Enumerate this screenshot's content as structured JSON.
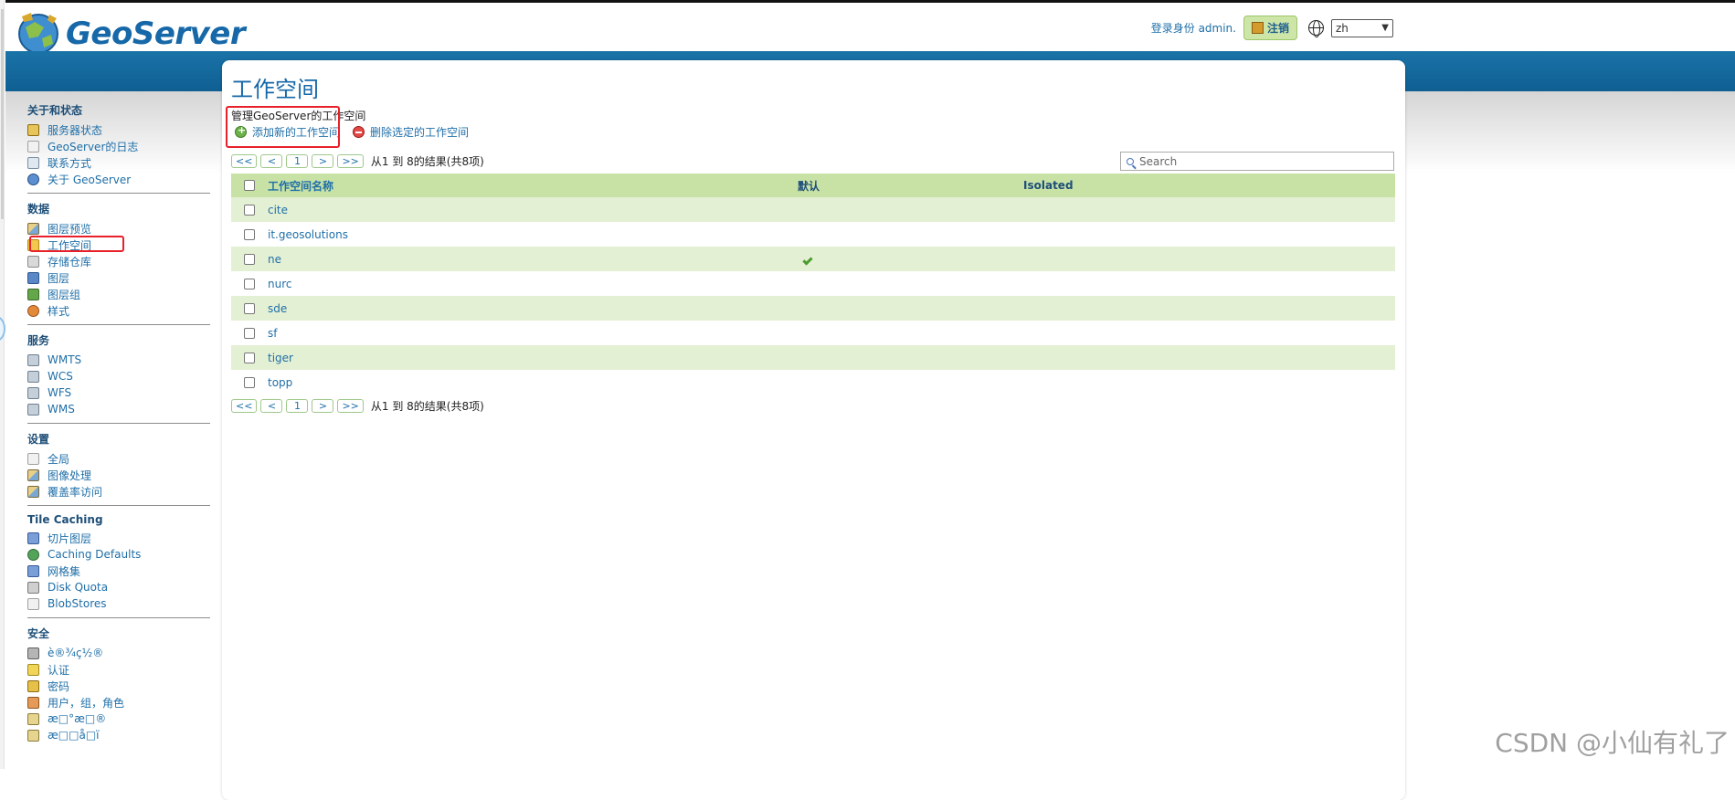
{
  "header": {
    "brand": "GeoServer",
    "login_label": "登录身份 admin.",
    "logout_label": "注销",
    "language": "zh"
  },
  "sidebar": {
    "sections": [
      {
        "title": "关于和状态",
        "items": [
          {
            "label": "服务器状态",
            "icon": "server-status-icon"
          },
          {
            "label": "GeoServer的日志",
            "icon": "log-icon"
          },
          {
            "label": "联系方式",
            "icon": "contact-icon"
          },
          {
            "label": "关于 GeoServer",
            "icon": "info-icon"
          }
        ]
      },
      {
        "title": "数据",
        "items": [
          {
            "label": "图层预览",
            "icon": "map-preview-icon"
          },
          {
            "label": "工作空间",
            "icon": "folder-icon"
          },
          {
            "label": "存储仓库",
            "icon": "store-icon"
          },
          {
            "label": "图层",
            "icon": "layer-icon"
          },
          {
            "label": "图层组",
            "icon": "layer-group-icon"
          },
          {
            "label": "样式",
            "icon": "style-icon"
          }
        ]
      },
      {
        "title": "服务",
        "items": [
          {
            "label": "WMTS",
            "icon": "service-icon"
          },
          {
            "label": "WCS",
            "icon": "service-icon"
          },
          {
            "label": "WFS",
            "icon": "service-icon"
          },
          {
            "label": "WMS",
            "icon": "service-icon"
          }
        ]
      },
      {
        "title": "设置",
        "items": [
          {
            "label": "全局",
            "icon": "settings-icon"
          },
          {
            "label": "图像处理",
            "icon": "image-processing-icon"
          },
          {
            "label": "覆盖率访问",
            "icon": "coverage-access-icon"
          }
        ]
      },
      {
        "title": "Tile Caching",
        "items": [
          {
            "label": "切片图层",
            "icon": "tile-layer-icon"
          },
          {
            "label": "Caching Defaults",
            "icon": "globe-icon"
          },
          {
            "label": "网格集",
            "icon": "grid-icon"
          },
          {
            "label": "Disk Quota",
            "icon": "disk-icon"
          },
          {
            "label": "BlobStores",
            "icon": "blobstore-icon"
          }
        ]
      },
      {
        "title": "安全",
        "items": [
          {
            "label": "è®¾ç½®",
            "icon": "key-icon"
          },
          {
            "label": "认证",
            "icon": "shield-icon"
          },
          {
            "label": "密码",
            "icon": "lock-icon"
          },
          {
            "label": "用户，组，角色",
            "icon": "users-icon"
          },
          {
            "label": "æ□°æ□®",
            "icon": "edit-icon"
          },
          {
            "label": "æ□□å□ï",
            "icon": "edit-icon"
          }
        ]
      }
    ]
  },
  "main": {
    "title": "工作空间",
    "description": "管理GeoServer的工作空间",
    "add_label": "添加新的工作空间",
    "remove_label": "删除选定的工作空间",
    "pager": {
      "first": "<<",
      "prev": "<",
      "page": "1",
      "next": ">",
      "last": ">>",
      "info": "从1 到 8的结果(共8项)"
    },
    "search_placeholder": "Search",
    "columns": {
      "name": "工作空间名称",
      "default": "默认",
      "isolated": "Isolated"
    },
    "rows": [
      {
        "name": "cite",
        "default": false
      },
      {
        "name": "it.geosolutions",
        "default": false
      },
      {
        "name": "ne",
        "default": true
      },
      {
        "name": "nurc",
        "default": false
      },
      {
        "name": "sde",
        "default": false
      },
      {
        "name": "sf",
        "default": false
      },
      {
        "name": "tiger",
        "default": false
      },
      {
        "name": "topp",
        "default": false
      }
    ]
  },
  "watermark": "CSDN @小仙有礼了",
  "colors": {
    "brand_blue": "#1668a8",
    "band_blue": "#1a73a8",
    "row_green": "#e4f0d4",
    "header_green": "#c8e2a6",
    "highlight_red": "#e8202a"
  }
}
